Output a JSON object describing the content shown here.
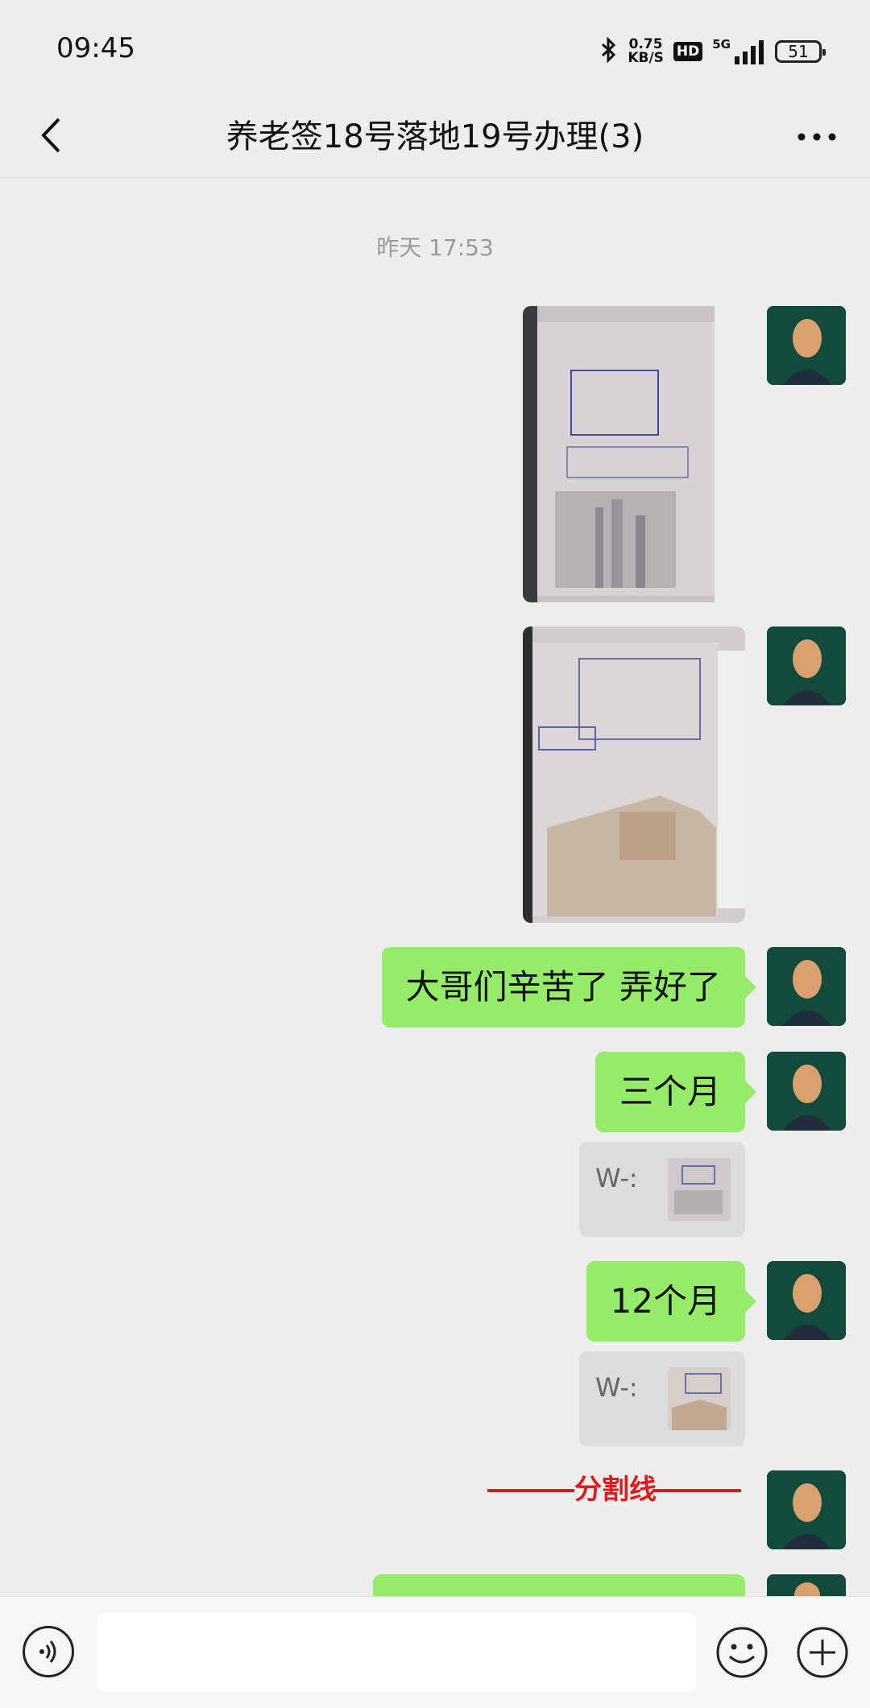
{
  "status_bar": {
    "time": "09:45",
    "net_speed_value": "0.75",
    "net_speed_unit": "KB/S",
    "hd_label": "HD",
    "network_label": "5G",
    "battery": "51"
  },
  "header": {
    "title": "养老签18号落地19号办理(3)"
  },
  "chat": {
    "timestamp": "昨天 17:53",
    "messages": [
      {
        "type": "image",
        "desc_icon": "passport-visa-page-image"
      },
      {
        "type": "image",
        "desc_icon": "passport-extension-page-image"
      },
      {
        "type": "text",
        "text": "大哥们辛苦了  弄好了"
      },
      {
        "type": "text",
        "text": "三个月"
      },
      {
        "type": "quote",
        "text": "W-:"
      },
      {
        "type": "text",
        "text": "12个月"
      },
      {
        "type": "quote",
        "text": "W-:"
      },
      {
        "type": "divider",
        "text": "分割线"
      }
    ]
  },
  "colors": {
    "bubble_green": "#95ec69",
    "divider_red": "#e11b1b",
    "background": "#ededed"
  }
}
